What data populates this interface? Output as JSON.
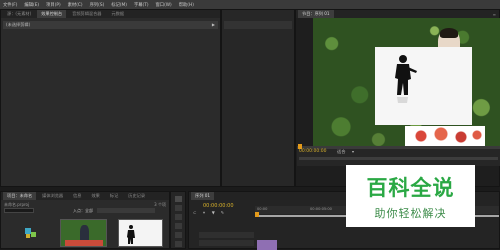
{
  "menu": [
    "文件(F)",
    "编辑(E)",
    "项目(P)",
    "素材(C)",
    "序列(S)",
    "标记(M)",
    "字幕(T)",
    "窗口(W)",
    "帮助(H)"
  ],
  "source_panel": {
    "tabs": [
      "源：(无素材)",
      "效果控制台",
      "音频剪辑混合器",
      "元数据"
    ],
    "subheader": "(未选择剪辑)"
  },
  "program_panel": {
    "tab": "节目：序列 01",
    "timecode": "00:00:00:00",
    "fit_label": "适合"
  },
  "project_panel": {
    "tabs": [
      "项目：未命名",
      "媒体浏览器",
      "信息",
      "效果",
      "标记",
      "历史记录"
    ],
    "project_file": "未命名.prproj",
    "item_count": "3 个项",
    "entry_label": "入点：全部"
  },
  "timeline_panel": {
    "tab": "序列 01",
    "timecode": "00:00:00:00",
    "ruler": [
      "00:00",
      "00:00:05:00",
      "00:00:10:00",
      "00:00:15:00"
    ]
  },
  "watermark": {
    "main": "百科全说",
    "sub": "助你轻松解决"
  },
  "colors": {
    "accent_orange": "#e39a1a",
    "timecode_yellow": "#d9b22b",
    "watermark_green": "#2aa844"
  }
}
